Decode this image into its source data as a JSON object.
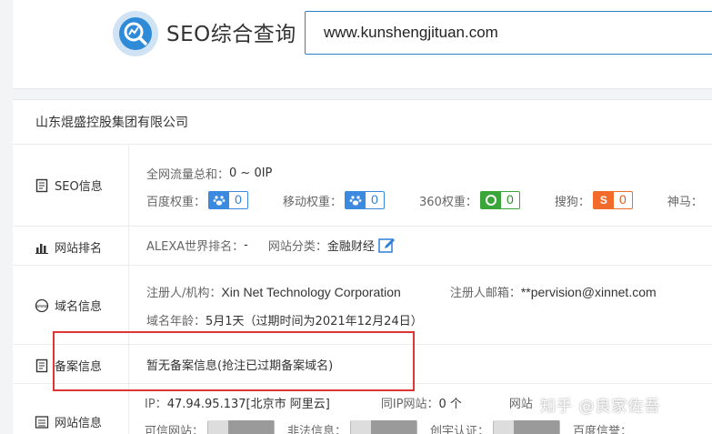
{
  "header": {
    "brand": "SEO综合查询",
    "search_value": "www.kunshengjituan.com"
  },
  "company": {
    "name": "山东焜盛控股集团有限公司"
  },
  "seo": {
    "label": "SEO信息",
    "traffic_label": "全网流量总和：",
    "traffic_value": "0 ~ 0IP",
    "weights": [
      {
        "label": "百度权重：",
        "value": "0",
        "icon": "baidu-paw-icon",
        "color": "#3c8ae0"
      },
      {
        "label": "移动权重：",
        "value": "0",
        "icon": "baidu-paw-icon",
        "color": "#3c8ae0"
      },
      {
        "label": "360权重：",
        "value": "0",
        "icon": "360-icon",
        "color": "#3aa63a"
      },
      {
        "label": "搜狗：",
        "value": "0",
        "icon": "sogou-icon",
        "color": "#f26b2a"
      },
      {
        "label": "神马：",
        "value": "",
        "icon": "",
        "color": ""
      }
    ]
  },
  "rank": {
    "label": "网站排名",
    "alexa_label": "ALEXA世界排名：",
    "alexa_value": "-",
    "category_label": "网站分类：",
    "category_value": "金融财经"
  },
  "domain": {
    "label": "域名信息",
    "registrant_label": "注册人/机构：",
    "registrant_value": "Xin Net Technology Corporation",
    "email_label": "注册人邮箱：",
    "email_value": "**pervision@xinnet.com",
    "age_label": "域名年龄：",
    "age_value": "5月1天（过期时间为2021年12月24日）"
  },
  "beian": {
    "label": "备案信息",
    "text": "暂无备案信息(抢注已过期备案域名)"
  },
  "site": {
    "label": "网站信息",
    "ip_label": "IP：",
    "ip_value": "47.94.95.137[北京市 阿里云]",
    "same_ip_label": "同IP网站：",
    "same_ip_value": "0 个",
    "speed_label": "网站",
    "row2": [
      "可信网站：",
      "非法信息：",
      "创宇认证：",
      "百度信誉："
    ]
  },
  "watermark": "知乎 @良家佐吾",
  "colors": {
    "accent": "#2f7fc9",
    "highlight": "#e03535"
  }
}
